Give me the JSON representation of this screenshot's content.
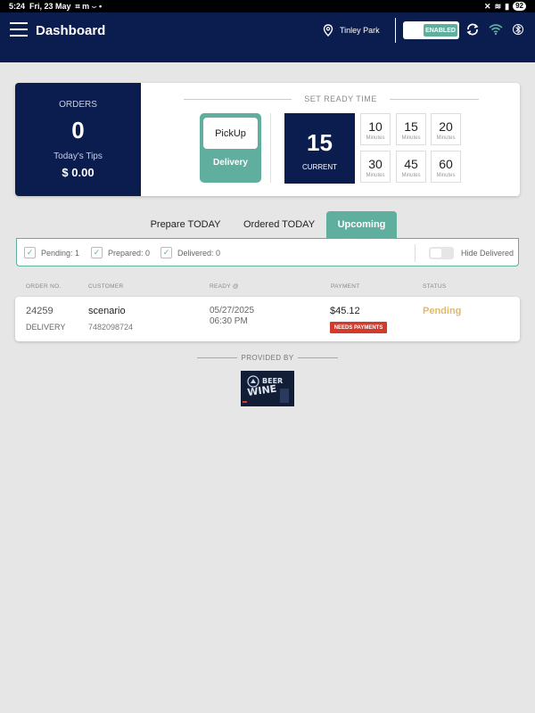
{
  "statusbar": {
    "time": "5:24",
    "date": "Fri, 23 May",
    "battery": "92"
  },
  "header": {
    "title": "Dashboard",
    "location": "Tinley Park",
    "enabled_label": "ENABLED"
  },
  "orders": {
    "label": "ORDERS",
    "count": "0",
    "tips_label": "Today's Tips",
    "tips_value": "$ 0.00"
  },
  "ready_time": {
    "label": "SET READY TIME",
    "pickup": "PickUp",
    "delivery": "Delivery",
    "current_value": "15",
    "current_label": "CURRENT",
    "unit": "Minutes",
    "options": [
      "10",
      "15",
      "20",
      "30",
      "45",
      "60"
    ]
  },
  "tabs": [
    "Prepare TODAY",
    "Ordered TODAY",
    "Upcoming"
  ],
  "active_tab": "Upcoming",
  "filters": {
    "pending": "Pending: 1",
    "prepared": "Prepared: 0",
    "delivered": "Delivered: 0",
    "hide_delivered": "Hide Delivered"
  },
  "columns": [
    "ORDER NO.",
    "CUSTOMER",
    "READY @",
    "PAYMENT",
    "STATUS"
  ],
  "order": {
    "number": "24259",
    "type": "DELIVERY",
    "customer": "scenario",
    "phone": "7482098724",
    "ready_date": "05/27/2025",
    "ready_time": "06:30 PM",
    "amount": "$45.12",
    "payment_badge": "NEEDS PAYMENTS",
    "status": "Pending"
  },
  "footer": {
    "provided_by": "PROVIDED BY",
    "logo_text_1": "BEER",
    "logo_text_2": "WINE"
  },
  "colors": {
    "navy": "#0b1c4f",
    "teal": "#5fae9e",
    "pending": "#e0b96a",
    "badge": "#d23b2b"
  }
}
